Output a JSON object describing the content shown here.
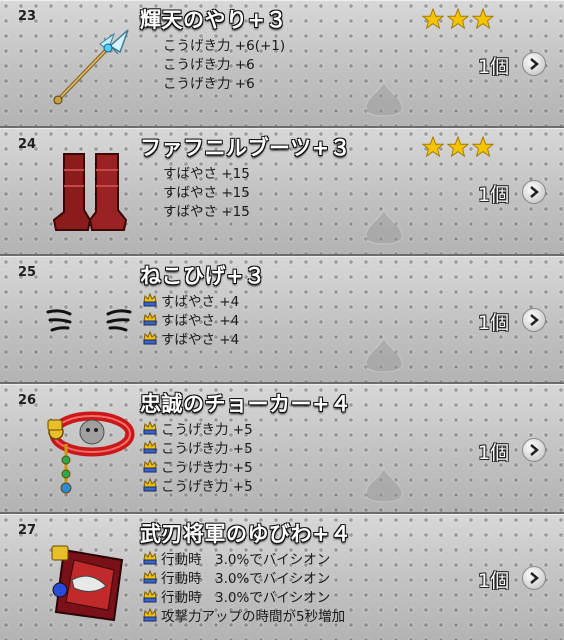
{
  "items": [
    {
      "index": "23",
      "name": "輝天のやり+３",
      "icon": "spear-icon",
      "stars": 3,
      "prop_icons": false,
      "properties": [
        "こうげき力 +6(+1)",
        "こうげき力 +6",
        "こうげき力 +6"
      ],
      "quantity": "1個"
    },
    {
      "index": "24",
      "name": "ファフニルブーツ+３",
      "icon": "boots-icon",
      "stars": 3,
      "prop_icons": false,
      "properties": [
        "すばやさ +15",
        "すばやさ +15",
        "すばやさ +15"
      ],
      "quantity": "1個"
    },
    {
      "index": "25",
      "name": "ねこひげ+３",
      "icon": "whiskers-icon",
      "stars": 0,
      "prop_icons": true,
      "properties": [
        "すばやさ +4",
        "すばやさ +4",
        "すばやさ +4"
      ],
      "quantity": "1個"
    },
    {
      "index": "26",
      "name": "忠誠のチョーカー+４",
      "icon": "choker-icon",
      "stars": 0,
      "prop_icons": true,
      "properties": [
        "こうげき力 +5",
        "こうげき力 +5",
        "こうげき力 +5",
        "こうげき力 +5"
      ],
      "quantity": "1個"
    },
    {
      "index": "27",
      "name": "武刃将軍のゆびわ+４",
      "icon": "ring-icon",
      "stars": 0,
      "prop_icons": true,
      "properties": [
        "行動時　3.0%でバイシオン",
        "行動時　3.0%でバイシオン",
        "行動時　3.0%でバイシオン",
        "攻撃力アップの時間が5秒増加"
      ],
      "quantity": "1個"
    }
  ],
  "colors": {
    "star": "#f5c400",
    "text": "#1a1a1a",
    "name_text": "#ffffff",
    "row_bg": "#c4c4c4"
  }
}
